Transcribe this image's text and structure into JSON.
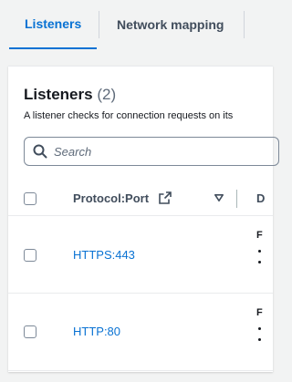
{
  "tabs": [
    {
      "label": "Listeners",
      "active": true
    },
    {
      "label": "Network mapping",
      "active": false
    }
  ],
  "panel": {
    "title": "Listeners",
    "count": "(2)",
    "description": "A listener checks for connection requests on its"
  },
  "search": {
    "placeholder": "Search"
  },
  "table": {
    "columns": [
      "Protocol:Port",
      "D"
    ],
    "rows": [
      {
        "protocol_port": "HTTPS:443",
        "next_col_initial": "F"
      },
      {
        "protocol_port": "HTTP:80",
        "next_col_initial": "F"
      }
    ]
  },
  "colors": {
    "accent": "#0972d3",
    "text": "#16191f",
    "muted": "#5f6b7a"
  },
  "icons": [
    "search-icon",
    "external-link-icon",
    "sort-down-icon"
  ]
}
